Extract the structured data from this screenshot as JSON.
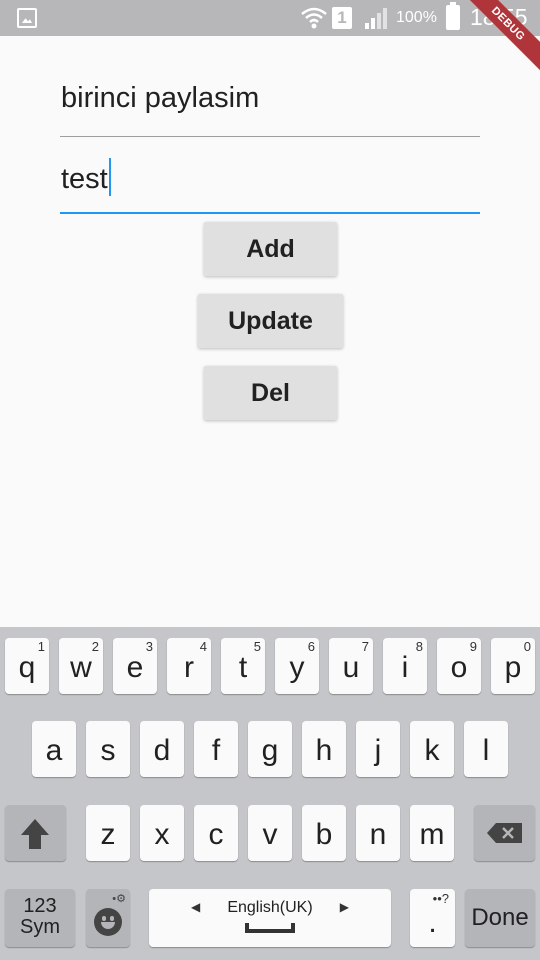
{
  "status_bar": {
    "sim_slot": "1",
    "battery_percent": "100%",
    "time": "18:55",
    "icons": [
      "image-notification-icon",
      "wifi-icon",
      "signal-icon",
      "battery-icon"
    ]
  },
  "debug_banner": "DEBUG",
  "form": {
    "title_value": "birinci paylasim",
    "body_value": "test",
    "add_label": "Add",
    "update_label": "Update",
    "delete_label": "Del",
    "focus_color": "#2196f3"
  },
  "keyboard": {
    "row1": [
      {
        "char": "q",
        "hint": "1"
      },
      {
        "char": "w",
        "hint": "2"
      },
      {
        "char": "e",
        "hint": "3"
      },
      {
        "char": "r",
        "hint": "4"
      },
      {
        "char": "t",
        "hint": "5"
      },
      {
        "char": "y",
        "hint": "6"
      },
      {
        "char": "u",
        "hint": "7"
      },
      {
        "char": "i",
        "hint": "8"
      },
      {
        "char": "o",
        "hint": "9"
      },
      {
        "char": "p",
        "hint": "0"
      }
    ],
    "row2": [
      "a",
      "s",
      "d",
      "f",
      "g",
      "h",
      "j",
      "k",
      "l"
    ],
    "row3": [
      "z",
      "x",
      "c",
      "v",
      "b",
      "n",
      "m"
    ],
    "sym_line1": "123",
    "sym_line2": "Sym",
    "space_label": "English(UK)",
    "period": ".",
    "period_hint": "••?",
    "done_label": "Done"
  }
}
